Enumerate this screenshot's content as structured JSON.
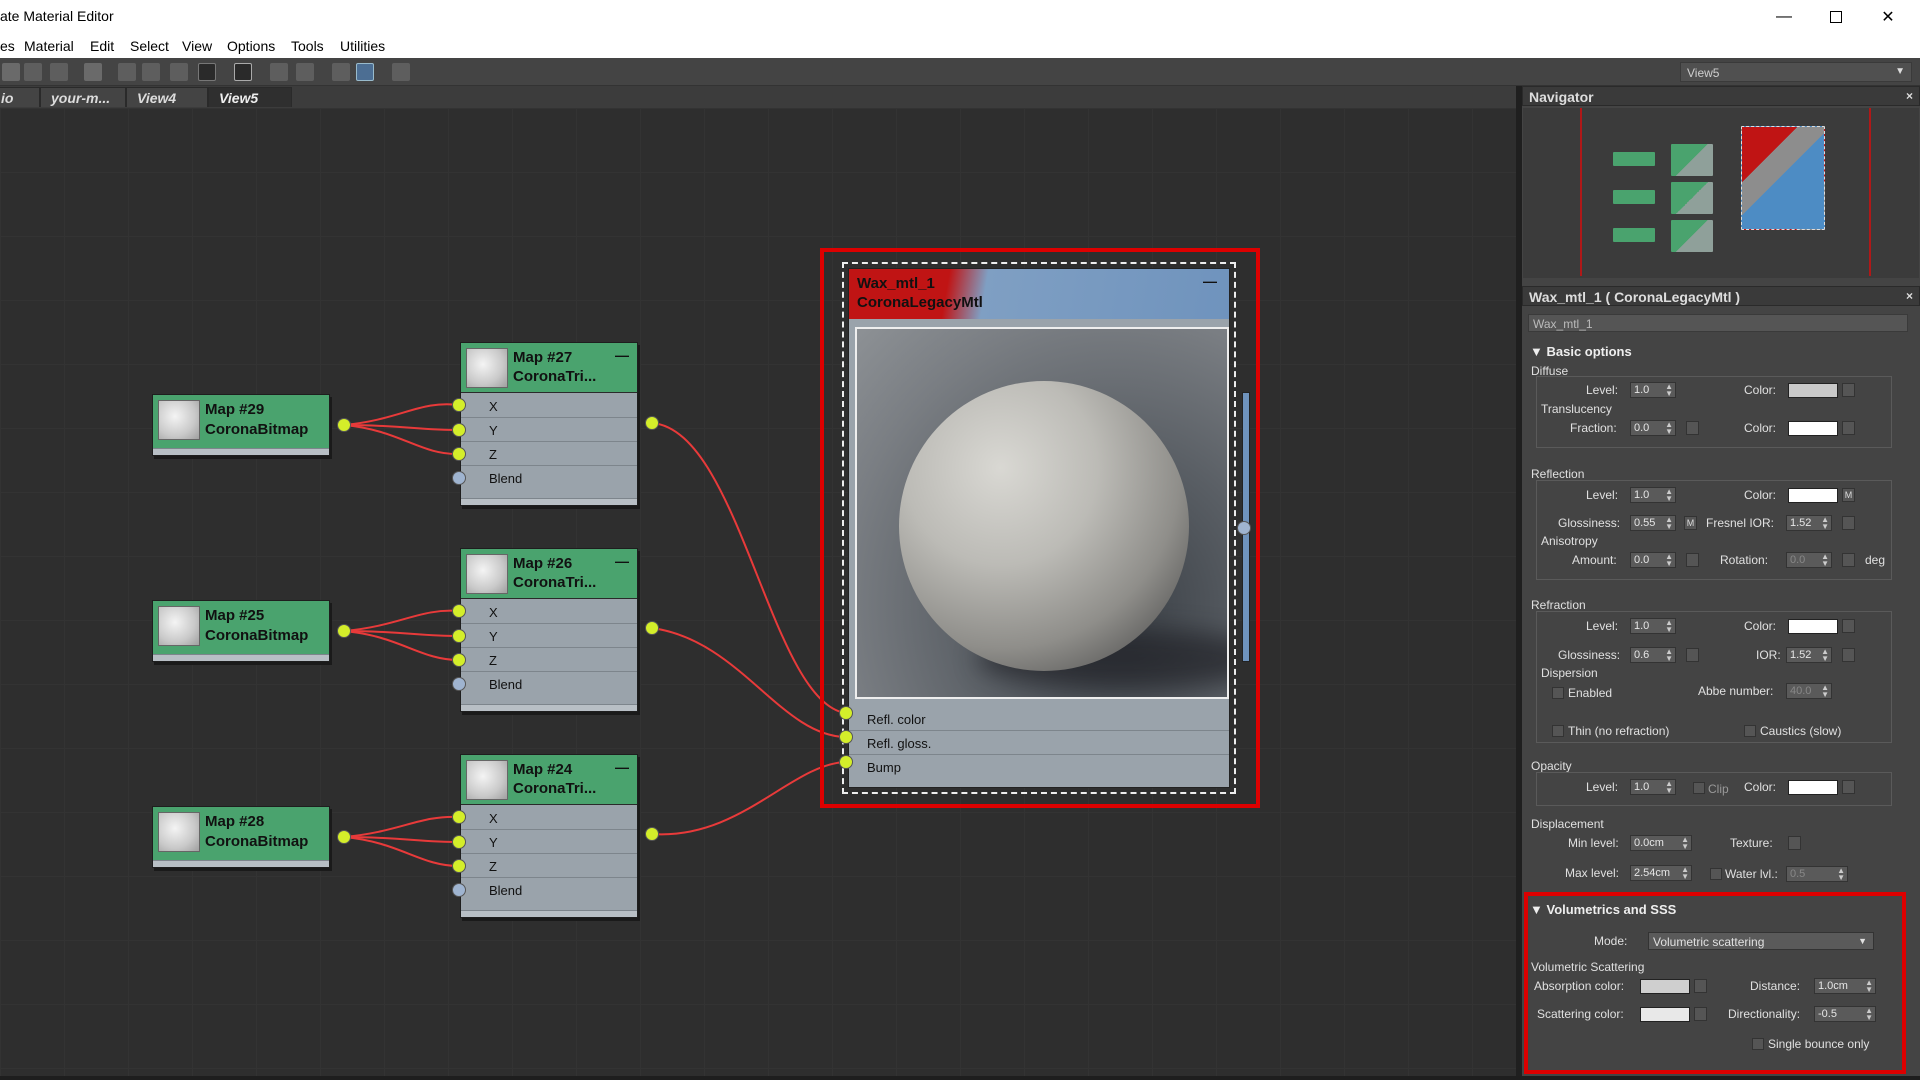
{
  "window": {
    "title": "ate Material Editor",
    "minimize_icon": "minimize-icon",
    "maximize_icon": "maximize-icon",
    "close_icon": "close-icon"
  },
  "menu": [
    "es",
    "Material",
    "Edit",
    "Select",
    "View",
    "Options",
    "Tools",
    "Utilities"
  ],
  "view_select": {
    "value": "View5"
  },
  "tabs": [
    {
      "label": "io"
    },
    {
      "label": "your-m..."
    },
    {
      "label": "View4"
    },
    {
      "label": "View5"
    }
  ],
  "nodes": {
    "map29": {
      "title": "Map #29",
      "subtitle": "CoronaBitmap"
    },
    "map25": {
      "title": "Map #25",
      "subtitle": "CoronaBitmap"
    },
    "map28": {
      "title": "Map #28",
      "subtitle": "CoronaBitmap"
    },
    "map27": {
      "title": "Map #27",
      "subtitle": "CoronaTri...",
      "rows": [
        "X",
        "Y",
        "Z",
        "Blend"
      ]
    },
    "map26": {
      "title": "Map #26",
      "subtitle": "CoronaTri...",
      "rows": [
        "X",
        "Y",
        "Z",
        "Blend"
      ]
    },
    "map24": {
      "title": "Map #24",
      "subtitle": "CoronaTri...",
      "rows": [
        "X",
        "Y",
        "Z",
        "Blend"
      ]
    },
    "material": {
      "title": "Wax_mtl_1",
      "subtitle": "CoronaLegacyMtl",
      "rows": [
        "Refl. color",
        "Refl. gloss.",
        "Bump"
      ]
    },
    "collapse_symbol": "—"
  },
  "navigator": {
    "title": "Navigator",
    "close": "×"
  },
  "props": {
    "title": "Wax_mtl_1  ( CoronaLegacyMtl )",
    "close": "×",
    "name_value": "Wax_mtl_1",
    "basic": {
      "header": "Basic options",
      "diffuse": "Diffuse",
      "level_lbl": "Level:",
      "level_val": "1.0",
      "color_lbl": "Color:",
      "translucency": "Translucency",
      "fraction_lbl": "Fraction:",
      "fraction_val": "0.0",
      "reflection": "Reflection",
      "refl_level_val": "1.0",
      "glossiness_lbl": "Glossiness:",
      "refl_gloss_val": "0.55",
      "m": "M",
      "fresnel_lbl": "Fresnel IOR:",
      "fresnel_val": "1.52",
      "anisotropy": "Anisotropy",
      "amount_lbl": "Amount:",
      "amount_val": "0.0",
      "rotation_lbl": "Rotation:",
      "rotation_val": "0.0",
      "deg": "deg",
      "refraction": "Refraction",
      "refr_level_val": "1.0",
      "refr_gloss_val": "0.6",
      "ior_lbl": "IOR:",
      "ior_val": "1.52",
      "dispersion": "Dispersion",
      "enabled": "Enabled",
      "abbe_lbl": "Abbe number:",
      "abbe_val": "40.0",
      "thin": "Thin (no refraction)",
      "caustics": "Caustics (slow)",
      "opacity": "Opacity",
      "op_level_val": "1.0",
      "clip": "Clip",
      "displacement": "Displacement",
      "min_level_lbl": "Min level:",
      "min_level_val": "0.0cm",
      "texture_lbl": "Texture:",
      "max_level_lbl": "Max level:",
      "max_level_val": "2.54cm",
      "water_lbl": "Water lvl.:",
      "water_val": "0.5"
    },
    "volumetrics": {
      "header": "Volumetrics and SSS",
      "mode_lbl": "Mode:",
      "mode_val": "Volumetric scattering",
      "vs": "Volumetric Scattering",
      "absorption_lbl": "Absorption color:",
      "distance_lbl": "Distance:",
      "distance_val": "1.0cm",
      "scattering_lbl": "Scattering color:",
      "directionality_lbl": "Directionality:",
      "directionality_val": "-0.5",
      "single_bounce": "Single bounce only"
    }
  },
  "colors": {
    "map_header": "#4aa36e",
    "socket": "#d4ee2a",
    "wire": "#e83a3a",
    "highlight": "#dd0000",
    "material_red": "#c01414",
    "material_blue": "#6f93bd"
  }
}
